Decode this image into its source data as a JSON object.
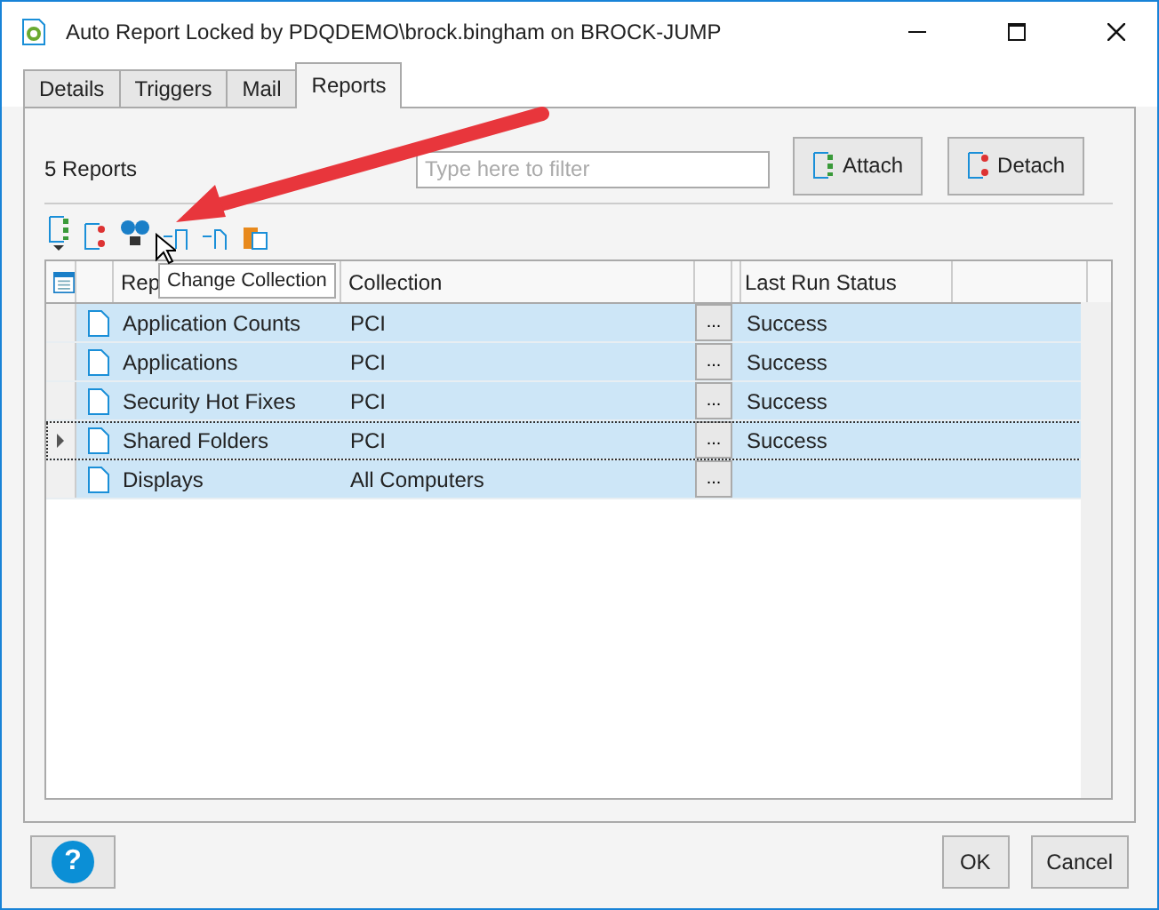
{
  "window": {
    "title": "Auto Report Locked by PDQDEMO\\brock.bingham on BROCK-JUMP"
  },
  "tabs": [
    {
      "label": "Details",
      "selected": false
    },
    {
      "label": "Triggers",
      "selected": false
    },
    {
      "label": "Mail",
      "selected": false
    },
    {
      "label": "Reports",
      "selected": true
    }
  ],
  "count_label": "5 Reports",
  "filter": {
    "placeholder": "Type here to filter"
  },
  "buttons": [
    {
      "label": "Attach",
      "kind": "attach"
    },
    {
      "label": "Detach",
      "kind": "detach"
    }
  ],
  "tooltip": "Change Collection",
  "table": {
    "columns": [
      "Rep",
      "Collection",
      "Last Run Status"
    ],
    "rows": [
      {
        "report": "Application Counts",
        "collection": "PCI",
        "ellipsis": "...",
        "status": "Success",
        "selected": true,
        "current": false
      },
      {
        "report": "Applications",
        "collection": "PCI",
        "ellipsis": "...",
        "status": "Success",
        "selected": true,
        "current": false
      },
      {
        "report": "Security Hot Fixes",
        "collection": "PCI",
        "ellipsis": "...",
        "status": "Success",
        "selected": true,
        "current": false
      },
      {
        "report": "Shared Folders",
        "collection": "PCI",
        "ellipsis": "...",
        "status": "Success",
        "selected": true,
        "current": true
      },
      {
        "report": "Displays",
        "collection": "All Computers",
        "ellipsis": "...",
        "selected": true,
        "current": false
      }
    ]
  },
  "footer": {
    "help": "?",
    "buttons": [
      "OK",
      "Cancel"
    ]
  }
}
